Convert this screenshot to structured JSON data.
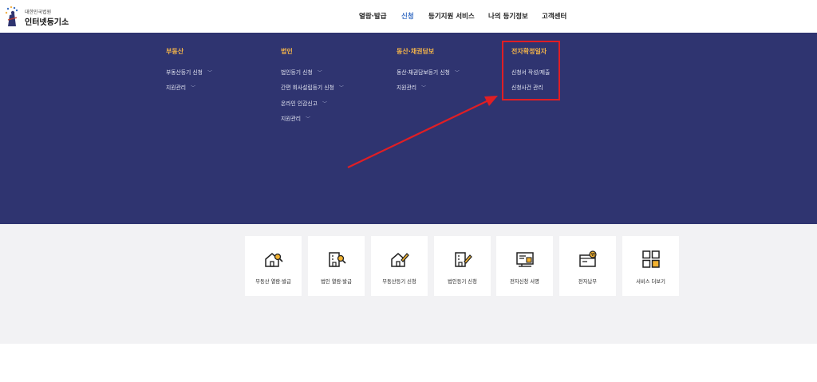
{
  "logo": {
    "small": "대한민국법원",
    "big": "인터넷등기소"
  },
  "nav": {
    "items": [
      {
        "label": "열람·발급"
      },
      {
        "label": "신청"
      },
      {
        "label": "등기지원 서비스"
      },
      {
        "label": "나의 등기정보"
      },
      {
        "label": "고객센터"
      }
    ],
    "active_index": 1
  },
  "mega_menu": {
    "columns": [
      {
        "title": "부동산",
        "items": [
          "부동산등기 신청",
          "지원관리"
        ]
      },
      {
        "title": "법인",
        "items": [
          "법인등기 신청",
          "간편 회사설립등기 신청",
          "온라인 인감신고",
          "지원관리"
        ]
      },
      {
        "title": "동산·채권담보",
        "items": [
          "동산·채권담보등기 신청",
          "지원관리"
        ]
      },
      {
        "title": "전자확정일자",
        "items": [
          "신청서 작성/제출",
          "신청사건 관리"
        ]
      }
    ]
  },
  "services": {
    "cards": [
      {
        "label": "부동산 열람·발급",
        "icon": "house-search-icon"
      },
      {
        "label": "법인 열람·발급",
        "icon": "building-search-icon"
      },
      {
        "label": "부동산등기 신청",
        "icon": "house-pen-icon"
      },
      {
        "label": "법인등기 신청",
        "icon": "building-pen-icon"
      },
      {
        "label": "전자신청 서명",
        "icon": "signature-icon"
      },
      {
        "label": "전자납부",
        "icon": "payment-icon"
      },
      {
        "label": "서비스 더보기",
        "icon": "grid-icon"
      }
    ]
  },
  "colors": {
    "menu_background": "#2f3470",
    "menu_title": "#f2b34a",
    "active_nav": "#3a6fc4",
    "annotation_red": "#e01e24",
    "icon_accent": "#f2b230"
  }
}
